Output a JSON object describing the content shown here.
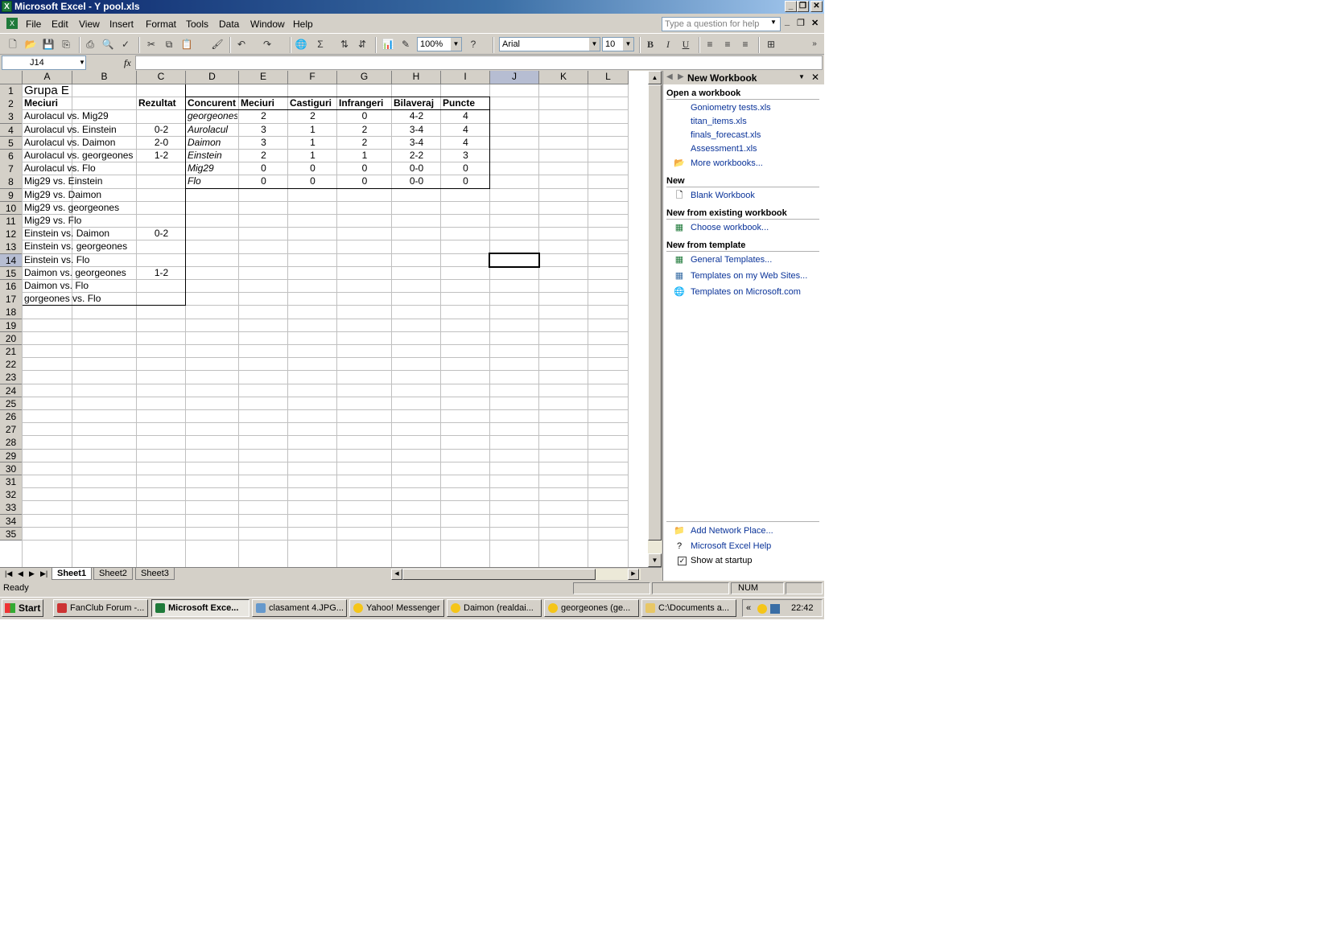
{
  "window": {
    "title": "Microsoft Excel - Y pool.xls"
  },
  "menubar": {
    "items": [
      "File",
      "Edit",
      "View",
      "Insert",
      "Format",
      "Tools",
      "Data",
      "Window",
      "Help"
    ],
    "help_placeholder": "Type a question for help"
  },
  "toolbar": {
    "zoom": "100%",
    "font": "Arial",
    "size": "10",
    "bold": "B",
    "italic": "I",
    "underline": "U"
  },
  "formula_bar": {
    "cell_ref": "J14",
    "fx": "fx",
    "content": ""
  },
  "grid": {
    "columns": [
      "A",
      "B",
      "C",
      "D",
      "E",
      "F",
      "G",
      "H",
      "I",
      "J",
      "K",
      "L"
    ],
    "rows": [
      "1",
      "2",
      "3",
      "4",
      "5",
      "6",
      "7",
      "8",
      "9",
      "10",
      "11",
      "12",
      "13",
      "14",
      "15",
      "16",
      "17",
      "18",
      "19",
      "20",
      "21",
      "22",
      "23",
      "24",
      "25",
      "26",
      "27",
      "28",
      "29",
      "30",
      "31",
      "32",
      "33",
      "34",
      "35"
    ],
    "selected_cell": "J14",
    "title": "Grupa E",
    "matches_header": "Meciuri",
    "result_header": "Rezultat",
    "matches": [
      {
        "name": "Aurolacul vs. Mig29",
        "result": ""
      },
      {
        "name": "Aurolacul vs. Einstein",
        "result": "0-2"
      },
      {
        "name": "Aurolacul vs. Daimon",
        "result": "2-0"
      },
      {
        "name": "Aurolacul vs. georgeones",
        "result": "1-2"
      },
      {
        "name": "Aurolacul vs. Flo",
        "result": ""
      },
      {
        "name": "Mig29 vs. Einstein",
        "result": ""
      },
      {
        "name": "Mig29 vs. Daimon",
        "result": ""
      },
      {
        "name": "Mig29 vs. georgeones",
        "result": ""
      },
      {
        "name": "Mig29 vs. Flo",
        "result": ""
      },
      {
        "name": "Einstein vs. Daimon",
        "result": "0-2"
      },
      {
        "name": "Einstein vs. georgeones",
        "result": ""
      },
      {
        "name": "Einstein vs. Flo",
        "result": ""
      },
      {
        "name": "Daimon vs. georgeones",
        "result": "1-2"
      },
      {
        "name": "Daimon vs. Flo",
        "result": ""
      },
      {
        "name": "gorgeones vs. Flo",
        "result": ""
      }
    ],
    "standings_headers": [
      "Concurent",
      "Meciuri",
      "Castiguri",
      "Infrangeri",
      "Bilaveraj",
      "Puncte"
    ],
    "standings": [
      [
        "georgeones",
        "2",
        "2",
        "0",
        "4-2",
        "4"
      ],
      [
        "Aurolacul",
        "3",
        "1",
        "2",
        "3-4",
        "4"
      ],
      [
        "Daimon",
        "3",
        "1",
        "2",
        "3-4",
        "4"
      ],
      [
        "Einstein",
        "2",
        "1",
        "1",
        "2-2",
        "3"
      ],
      [
        "Mig29",
        "0",
        "0",
        "0",
        "0-0",
        "0"
      ],
      [
        "Flo",
        "0",
        "0",
        "0",
        "0-0",
        "0"
      ]
    ]
  },
  "sheet_tabs": [
    "Sheet1",
    "Sheet2",
    "Sheet3"
  ],
  "task_pane": {
    "title": "New Workbook",
    "open_header": "Open a workbook",
    "recent": [
      "Goniometry tests.xls",
      "titan_items.xls",
      "finals_forecast.xls",
      "Assessment1.xls"
    ],
    "more": "More workbooks...",
    "new_header": "New",
    "blank": "Blank Workbook",
    "existing_header": "New from existing workbook",
    "choose": "Choose workbook...",
    "template_header": "New from template",
    "templates": [
      "General Templates...",
      "Templates on my Web Sites...",
      "Templates on Microsoft.com"
    ],
    "add_network": "Add Network Place...",
    "excel_help": "Microsoft Excel Help",
    "show_startup": "Show at startup"
  },
  "status": {
    "left": "Ready",
    "num": "NUM"
  },
  "taskbar": {
    "start": "Start",
    "tasks": [
      "FanClub Forum -...",
      "Microsoft Exce...",
      "clasament 4.JPG...",
      "Yahoo! Messenger",
      "Daimon  (realdai...",
      "georgeones  (ge...",
      "C:\\Documents a..."
    ],
    "clock": "22:42"
  }
}
